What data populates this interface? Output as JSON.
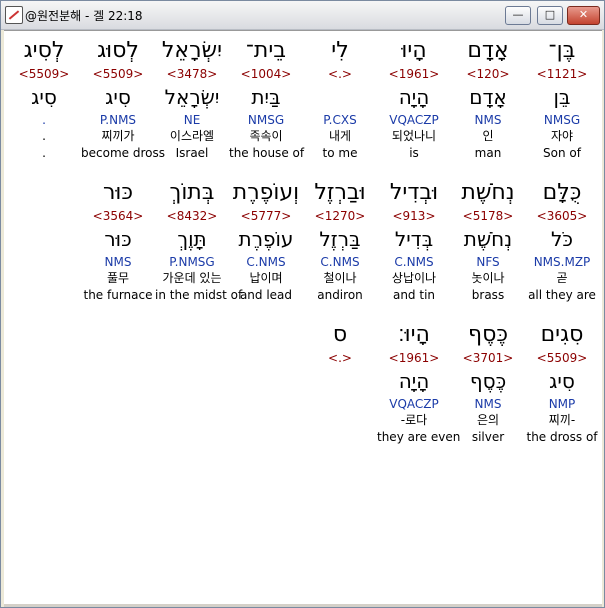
{
  "window": {
    "title": "@원전분해 - 겔 22:18"
  },
  "titlebar_buttons": {
    "minimize": "—",
    "maximize": "□",
    "close": "✕"
  },
  "rows": [
    [
      {
        "heb": "בֶּן־",
        "strong": "<1121>",
        "lemma": "בֵּן",
        "morph": "NMSG",
        "ko": "자야",
        "en": "Son of"
      },
      {
        "heb": "אָדָם",
        "strong": "<120>",
        "lemma": "אָדָם",
        "morph": "NMS",
        "ko": "인",
        "en": "man"
      },
      {
        "heb": "הָיוּ",
        "strong": "<1961>",
        "lemma": "הָיָה",
        "morph": "VQACZP",
        "ko": "되었나니",
        "en": "is"
      },
      {
        "heb": "לִי",
        "strong": "<.>",
        "lemma": "",
        "morph": "P.CXS",
        "ko": "내게",
        "en": "to me"
      },
      {
        "heb": "בֵית־",
        "strong": "<1004>",
        "lemma": "בַּיִת",
        "morph": "NMSG",
        "ko": "족속이",
        "en": "the house of"
      },
      {
        "heb": "יִשְׂרָאֵל",
        "strong": "<3478>",
        "lemma": "יִשְׂרָאֵל",
        "morph": "NE",
        "ko": "이스라엘",
        "en": "Israel"
      },
      {
        "heb": "לְסוּג",
        "strong": "<5509>",
        "lemma": "סִיג",
        "morph": "P.NMS",
        "ko": "찌끼가",
        "en": "become dross"
      },
      {
        "heb": "לְסִיג",
        "strong": "<5509>",
        "lemma": "סִיג",
        "morph": ".",
        "ko": ".",
        "en": "."
      }
    ],
    [
      {
        "heb": "כֻּלָּם",
        "strong": "<3605>",
        "lemma": "כֹּל",
        "morph": "NMS.MZP",
        "ko": "곧",
        "en": "all they are"
      },
      {
        "heb": "נְחֹשֶׁת",
        "strong": "<5178>",
        "lemma": "נְחֹשֶׁת",
        "morph": "NFS",
        "ko": "놋이나",
        "en": "brass"
      },
      {
        "heb": "וּבְדִיל",
        "strong": "<913>",
        "lemma": "בְּדִיל",
        "morph": "C.NMS",
        "ko": "상납이나",
        "en": "and tin"
      },
      {
        "heb": "וּבַרְזֶל",
        "strong": "<1270>",
        "lemma": "בַּרְזֶל",
        "morph": "C.NMS",
        "ko": "철이나",
        "en": "andiron"
      },
      {
        "heb": "וְעוֹפֶרֶת",
        "strong": "<5777>",
        "lemma": "עוֹפֶרֶת",
        "morph": "C.NMS",
        "ko": "납이며",
        "en": "and lead"
      },
      {
        "heb": "בְּתוֹךְ",
        "strong": "<8432>",
        "lemma": "תָּוֶךְ",
        "morph": "P.NMSG",
        "ko": "가운데 있는",
        "en": "in the midst of"
      },
      {
        "heb": "כּוּר",
        "strong": "<3564>",
        "lemma": "כּוּר",
        "morph": "NMS",
        "ko": "풀무",
        "en": "the furnace"
      }
    ],
    [
      {
        "heb": "סִגִים",
        "strong": "<5509>",
        "lemma": "סִיג",
        "morph": "NMP",
        "ko": "찌끼-",
        "en": "the dross of"
      },
      {
        "heb": "כֶּסֶף",
        "strong": "<3701>",
        "lemma": "כֶּסֶף",
        "morph": "NMS",
        "ko": "은의",
        "en": "silver"
      },
      {
        "heb": "הָיוּ׃",
        "strong": "<1961>",
        "lemma": "הָיָה",
        "morph": "VQACZP",
        "ko": "-로다",
        "en": "they are even"
      },
      {
        "heb": "ס",
        "strong": "<.>",
        "lemma": "",
        "morph": "",
        "ko": "",
        "en": ""
      }
    ]
  ]
}
